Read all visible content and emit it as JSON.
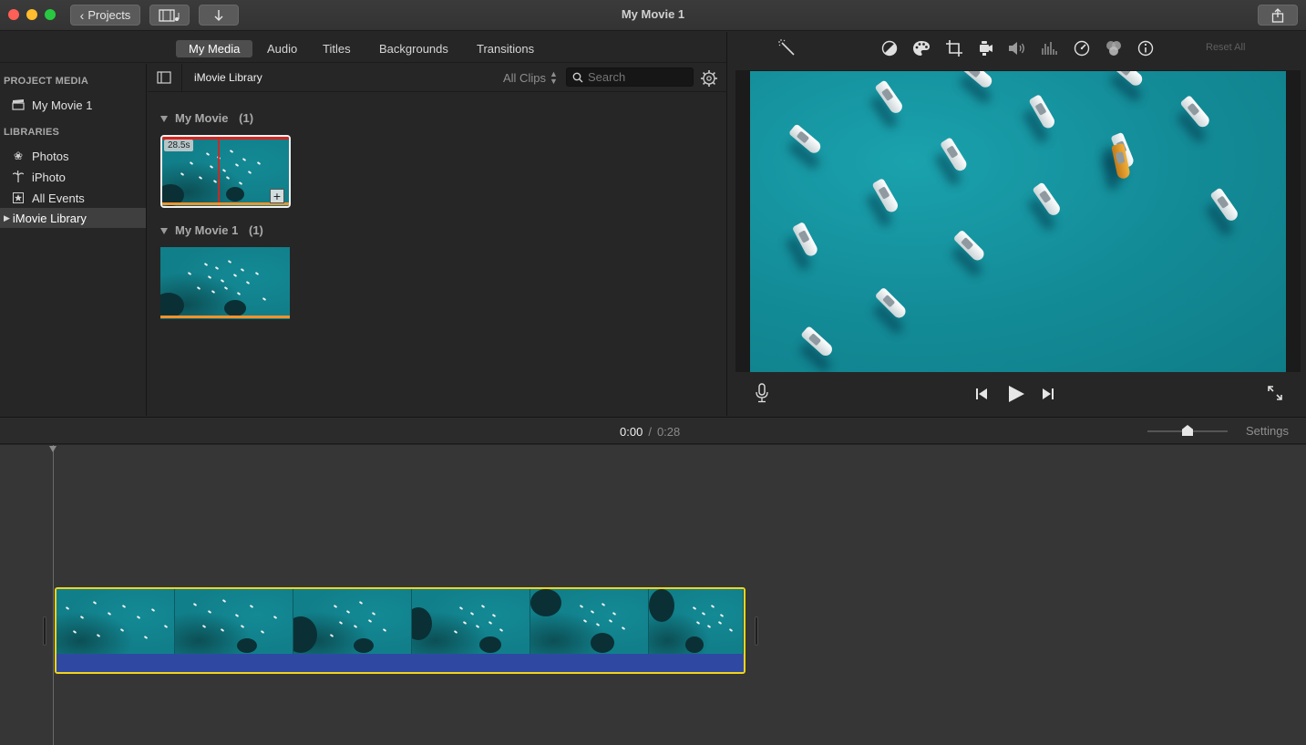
{
  "window": {
    "title": "My Movie 1",
    "back_label": "Projects",
    "traffic_colors": [
      "#fe5f57",
      "#febc2e",
      "#28c840"
    ]
  },
  "tabs": [
    {
      "label": "My Media",
      "active": true
    },
    {
      "label": "Audio",
      "active": false
    },
    {
      "label": "Titles",
      "active": false
    },
    {
      "label": "Backgrounds",
      "active": false
    },
    {
      "label": "Transitions",
      "active": false
    }
  ],
  "sidebar": {
    "project_media_heading": "PROJECT MEDIA",
    "project_item": "My Movie 1",
    "libraries_heading": "LIBRARIES",
    "items": [
      {
        "label": "Photos",
        "icon": "photos-icon"
      },
      {
        "label": "iPhoto",
        "icon": "iphoto-icon"
      },
      {
        "label": "All Events",
        "icon": "star-icon"
      }
    ],
    "library": "iMovie Library"
  },
  "browser": {
    "library_title": "iMovie Library",
    "filter": "All Clips",
    "search_placeholder": "Search",
    "events": [
      {
        "name": "My Movie",
        "count": "(1)",
        "duration_badge": "28.5s"
      },
      {
        "name": "My Movie 1",
        "count": "(1)"
      }
    ]
  },
  "viewer": {
    "reset_label": "Reset All",
    "toolbar_icons": [
      "magic-wand-icon",
      "color-balance-icon",
      "color-correction-icon",
      "crop-icon",
      "stabilization-icon",
      "volume-icon",
      "noise-reduction-icon",
      "speed-icon",
      "clip-filter-icon",
      "info-icon"
    ]
  },
  "timeline": {
    "current_time": "0:00",
    "separator": "/",
    "total_time": "0:28",
    "settings_label": "Settings",
    "zoom_level": 0.5
  },
  "colors": {
    "clip_border": "#f2d419",
    "audio_lane": "#2f49a3",
    "accent_orange": "#f0932b"
  }
}
